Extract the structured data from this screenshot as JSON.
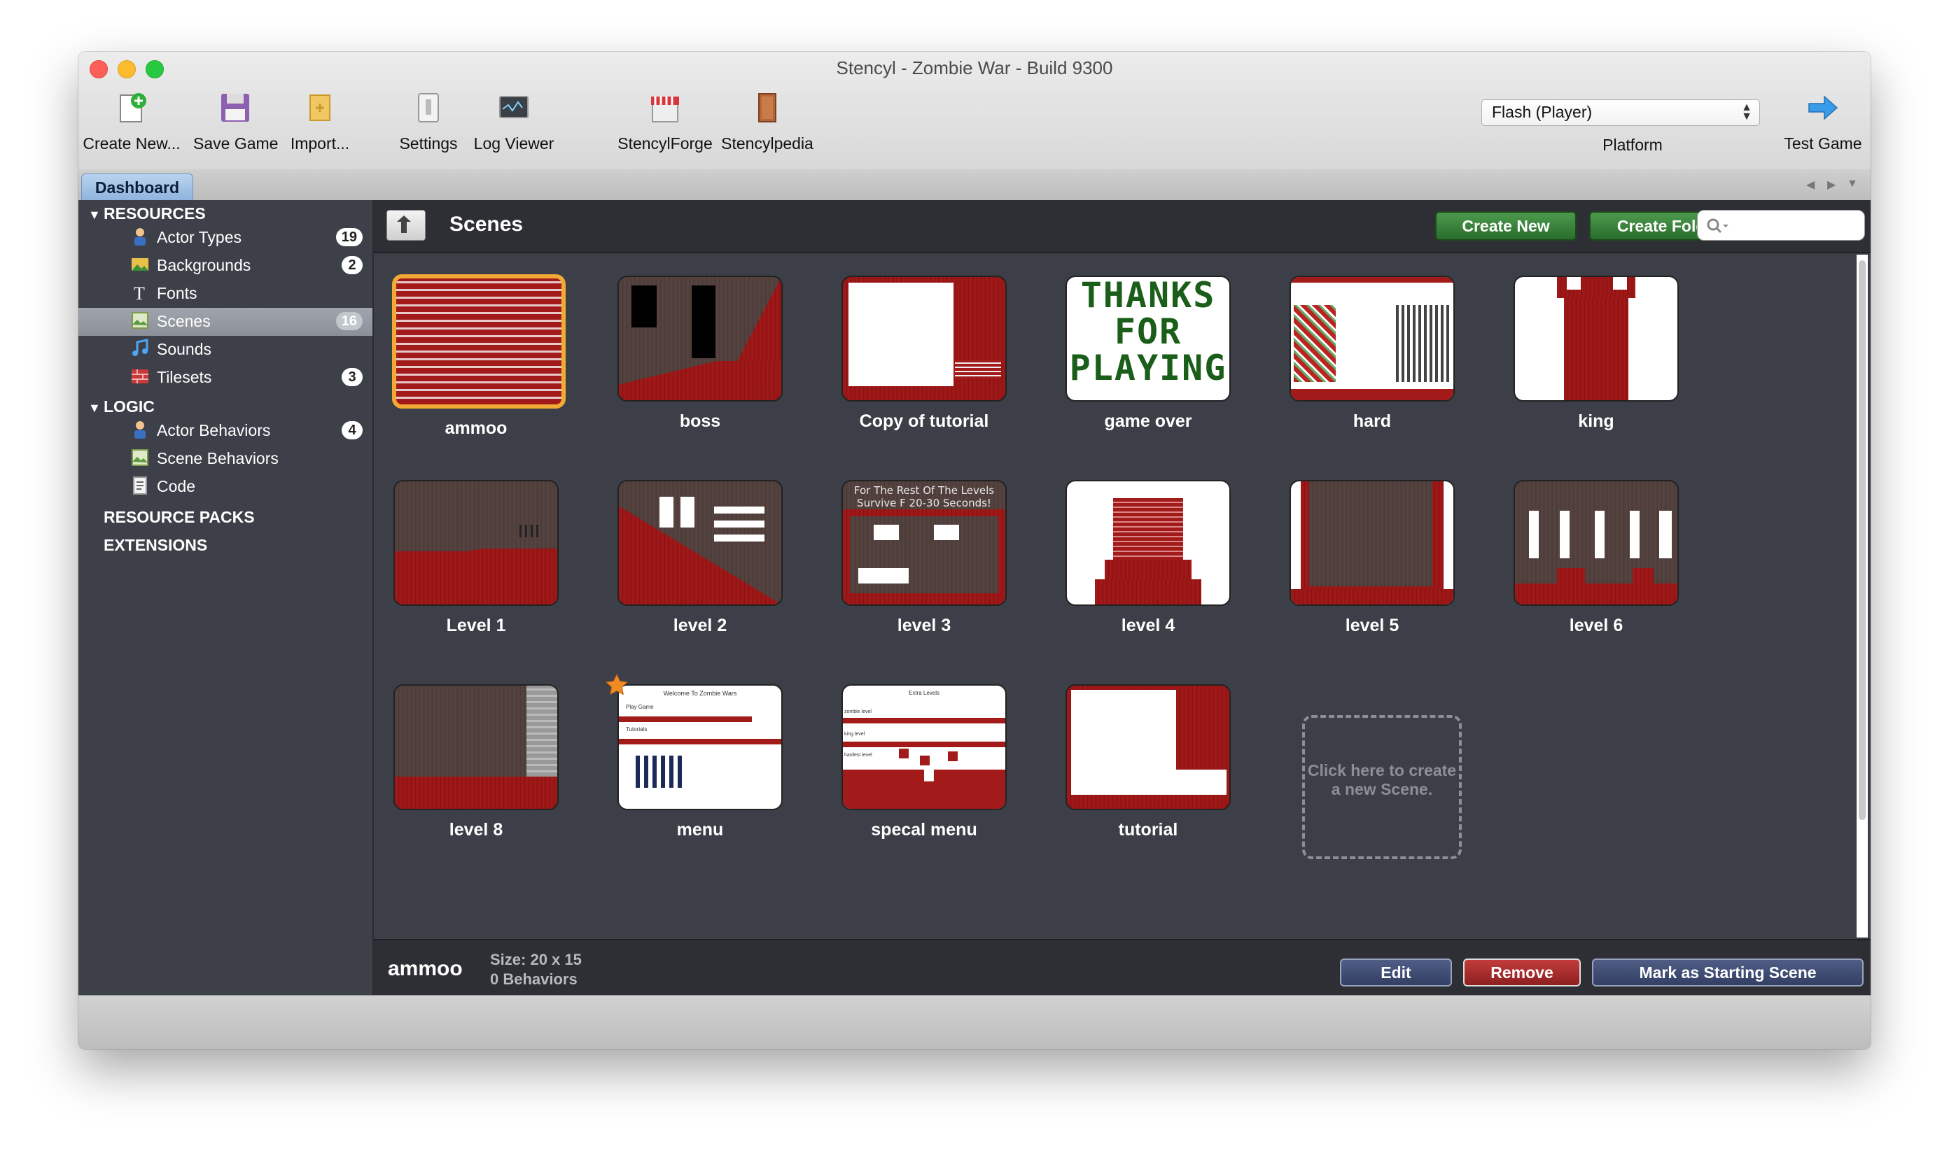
{
  "window": {
    "title": "Stencyl - Zombie War - Build 9300"
  },
  "toolbar": {
    "create_new": "Create New...",
    "save_game": "Save Game",
    "import": "Import...",
    "settings": "Settings",
    "log_viewer": "Log Viewer",
    "stencylforge": "StencylForge",
    "stencylpedia": "Stencylpedia",
    "platform_value": "Flash (Player)",
    "platform_label": "Platform",
    "test_game": "Test Game"
  },
  "tabs": {
    "dashboard": "Dashboard"
  },
  "sidebar": {
    "resources_header": "RESOURCES",
    "resources": [
      {
        "label": "Actor Types",
        "badge": "19",
        "icon": "actor-icon"
      },
      {
        "label": "Backgrounds",
        "badge": "2",
        "icon": "background-icon"
      },
      {
        "label": "Fonts",
        "badge": "",
        "icon": "font-icon"
      },
      {
        "label": "Scenes",
        "badge": "16",
        "icon": "scene-icon"
      },
      {
        "label": "Sounds",
        "badge": "",
        "icon": "sound-icon"
      },
      {
        "label": "Tilesets",
        "badge": "3",
        "icon": "tileset-icon"
      }
    ],
    "logic_header": "LOGIC",
    "logic": [
      {
        "label": "Actor Behaviors",
        "badge": "4",
        "icon": "actor-behavior-icon"
      },
      {
        "label": "Scene Behaviors",
        "badge": "",
        "icon": "scene-behavior-icon"
      },
      {
        "label": "Code",
        "badge": "",
        "icon": "code-icon"
      }
    ],
    "resource_packs": "RESOURCE PACKS",
    "extensions": "EXTENSIONS"
  },
  "main": {
    "title": "Scenes",
    "create_new": "Create New",
    "create_folder": "Create Folder",
    "search_placeholder": ""
  },
  "scenes": [
    {
      "name": "ammoo",
      "selected": true
    },
    {
      "name": "boss"
    },
    {
      "name": "Copy of tutorial"
    },
    {
      "name": "game over",
      "thumb_text": "THANKS FOR PLAYING"
    },
    {
      "name": "hard"
    },
    {
      "name": "king"
    },
    {
      "name": "Level 1"
    },
    {
      "name": "level 2"
    },
    {
      "name": "level 3",
      "thumb_text": "For The Rest Of The Levels Survive F 20-30 Seconds!"
    },
    {
      "name": "level 4"
    },
    {
      "name": "level 5"
    },
    {
      "name": "level 6"
    },
    {
      "name": "level 8"
    },
    {
      "name": "menu",
      "starting": true,
      "thumb_text": [
        "Welcome To Zombie Wars",
        "Play Game",
        "Tutorials"
      ]
    },
    {
      "name": "specal menu",
      "thumb_text": [
        "Extra Levels",
        "zombie level",
        "king level",
        "hardest level"
      ]
    },
    {
      "name": "tutorial"
    }
  ],
  "new_scene_hint": "Click here to create a new Scene.",
  "status": {
    "selected_name": "ammoo",
    "size": "Size: 20 x 15",
    "behaviors": "0 Behaviors",
    "edit": "Edit",
    "remove": "Remove",
    "mark_starting": "Mark as Starting Scene"
  }
}
